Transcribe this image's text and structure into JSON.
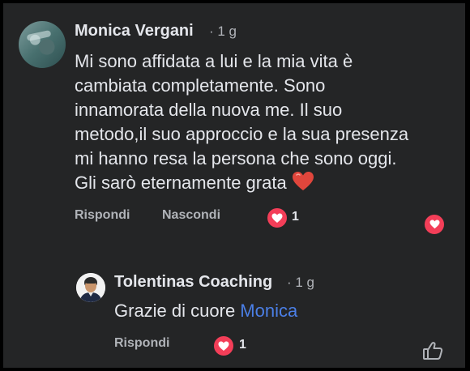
{
  "comment": {
    "author": "Monica Vergani",
    "time": "· 1 g",
    "lines": [
      "Mi sono affidata a lui e la mia vita è",
      "cambiata completamente. Sono",
      "innamorata della nuova me. Il suo",
      "metodo,il suo approccio e la sua presenza",
      "mi hanno resa la persona che sono oggi.",
      "Gli sarò eternamente grata"
    ],
    "emoji": "heart-emoji",
    "reply_label": "Rispondi",
    "hide_label": "Nascondi",
    "reaction_count": "1"
  },
  "reply": {
    "author": "Tolentinas Coaching",
    "time": "· 1 g",
    "text": "Grazie di cuore ",
    "mention": "Monica",
    "reply_label": "Rispondi",
    "reaction_count": "1"
  },
  "colors": {
    "background": "#242526",
    "text": "#e4e6eb",
    "muted": "#b0b3b8",
    "love_reaction": "#f33e58",
    "mention": "#4b7fe6"
  }
}
